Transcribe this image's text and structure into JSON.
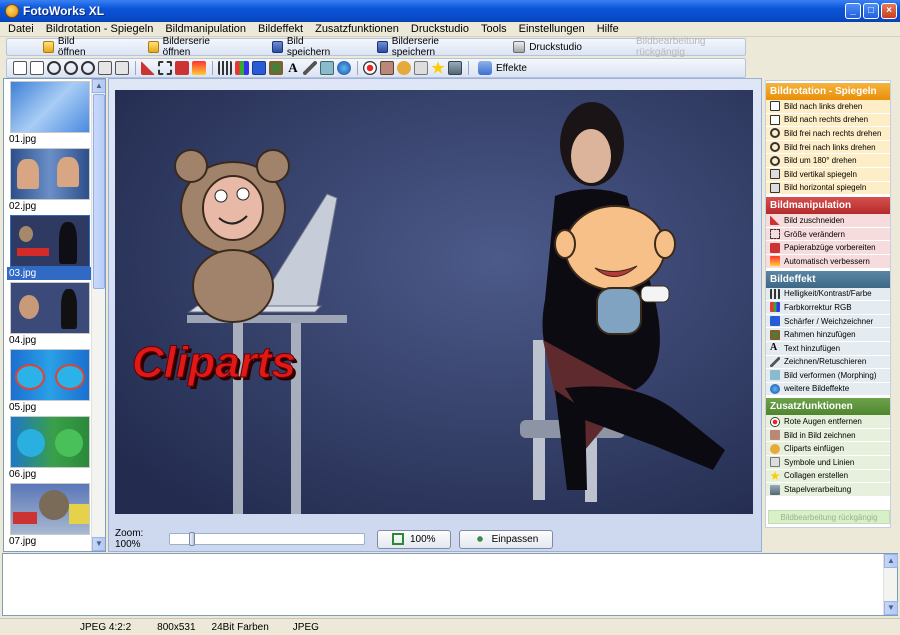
{
  "window": {
    "title": "FotoWorks XL"
  },
  "menu": [
    {
      "label": "Datei"
    },
    {
      "label": "Bildrotation - Spiegeln"
    },
    {
      "label": "Bildmanipulation"
    },
    {
      "label": "Bildeffekt"
    },
    {
      "label": "Zusatzfunktionen"
    },
    {
      "label": "Druckstudio"
    },
    {
      "label": "Tools"
    },
    {
      "label": "Einstellungen"
    },
    {
      "label": "Hilfe"
    }
  ],
  "toolbar": {
    "open_label": "Bild öffnen",
    "open_series_label": "Bilderserie öffnen",
    "save_label": "Bild speichern",
    "save_series_label": "Bilderserie speichern",
    "print_label": "Druckstudio",
    "undo_label": "Bildbearbeitung rückgängig",
    "effects_label": "Effekte"
  },
  "thumbnails": [
    {
      "name": "01.jpg"
    },
    {
      "name": "02.jpg"
    },
    {
      "name": "03.jpg",
      "selected": true
    },
    {
      "name": "04.jpg"
    },
    {
      "name": "05.jpg"
    },
    {
      "name": "06.jpg"
    },
    {
      "name": "07.jpg"
    }
  ],
  "canvas": {
    "clipart_text": "Cliparts"
  },
  "zoom": {
    "label": "Zoom: 100%",
    "btn_100": "100%",
    "btn_fit": "Einpassen",
    "level": 0.05
  },
  "panel": {
    "rotation": {
      "title": "Bildrotation - Spiegeln",
      "items": [
        "Bild nach links drehen",
        "Bild nach rechts drehen",
        "Bild frei nach rechts drehen",
        "Bild frei nach links drehen",
        "Bild um 180° drehen",
        "Bild vertikal spiegeln",
        "Bild horizontal spiegeln"
      ]
    },
    "manipulation": {
      "title": "Bildmanipulation",
      "items": [
        "Bild zuschneiden",
        "Größe verändern",
        "Papierabzüge vorbereiten",
        "Automatisch verbessern"
      ]
    },
    "effect": {
      "title": "Bildeffekt",
      "items": [
        "Helligkeit/Kontrast/Farbe",
        "Farbkorrektur RGB",
        "Schärfer / Weichzeichner",
        "Rahmen hinzufügen",
        "Text hinzufügen",
        "Zeichnen/Retuschieren",
        "Bild verformen (Morphing)",
        "weitere Bildeffekte"
      ]
    },
    "extras": {
      "title": "Zusatzfunktionen",
      "items": [
        "Rote Augen entfernen",
        "Bild in Bild zeichnen",
        "Cliparts einfügen",
        "Symbole und Linien",
        "Collagen erstellen",
        "Stapelverarbeitung"
      ]
    },
    "undo_label": "Bildbearbeitung rückgängig"
  },
  "status": {
    "format": "JPEG 4:2:2",
    "size": "800x531",
    "colors": "24Bit Farben",
    "type": "JPEG"
  },
  "colors": {
    "title_bar": "#0a55d8",
    "accent": "#316ac5"
  }
}
